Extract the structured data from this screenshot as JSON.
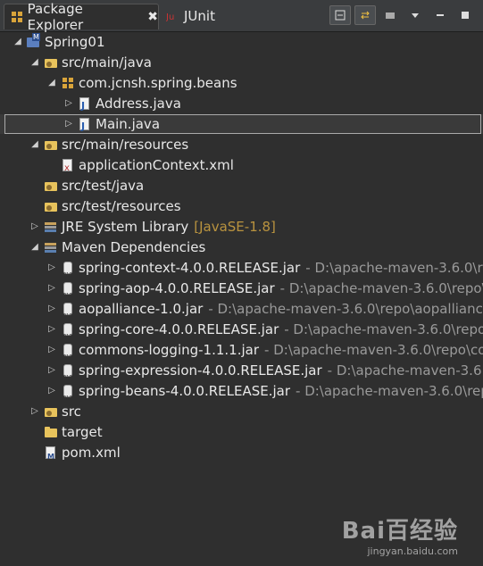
{
  "tabs": [
    {
      "label": "Package Explorer",
      "close": "✖"
    },
    {
      "label": "JUnit"
    }
  ],
  "tree": [
    {
      "label": "Spring01",
      "icon": "project-icon",
      "indent": 0,
      "expanded": true
    },
    {
      "label": "src/main/java",
      "icon": "source-folder-icon",
      "indent": 1,
      "expanded": true
    },
    {
      "label": "com.jcnsh.spring.beans",
      "icon": "package-icon",
      "indent": 2,
      "expanded": true
    },
    {
      "label": "Address.java",
      "icon": "java-file-icon",
      "indent": 3,
      "expanded": false
    },
    {
      "label": "Main.java",
      "icon": "java-file-icon",
      "indent": 3,
      "expanded": false,
      "selected": true
    },
    {
      "label": "src/main/resources",
      "icon": "source-folder-icon",
      "indent": 1,
      "expanded": true
    },
    {
      "label": "applicationContext.xml",
      "icon": "xml-file-icon",
      "indent": 2,
      "leaf": true
    },
    {
      "label": "src/test/java",
      "icon": "source-folder-icon",
      "indent": 1,
      "leaf": true
    },
    {
      "label": "src/test/resources",
      "icon": "source-folder-icon",
      "indent": 1,
      "leaf": true
    },
    {
      "label": "JRE System Library",
      "decoration": "[JavaSE-1.8]",
      "icon": "library-icon",
      "indent": 1,
      "expanded": false
    },
    {
      "label": "Maven Dependencies",
      "icon": "library-icon",
      "indent": 1,
      "expanded": true
    },
    {
      "label": "spring-context-4.0.0.RELEASE.jar",
      "decoration": "- D:\\apache-maven-3.6.0\\repo",
      "icon": "jar-icon",
      "indent": 2,
      "expanded": false
    },
    {
      "label": "spring-aop-4.0.0.RELEASE.jar",
      "decoration": "- D:\\apache-maven-3.6.0\\repo\\o",
      "icon": "jar-icon",
      "indent": 2,
      "expanded": false
    },
    {
      "label": "aopalliance-1.0.jar",
      "decoration": "- D:\\apache-maven-3.6.0\\repo\\aopalliance\\",
      "icon": "jar-icon",
      "indent": 2,
      "expanded": false
    },
    {
      "label": "spring-core-4.0.0.RELEASE.jar",
      "decoration": "- D:\\apache-maven-3.6.0\\repo\\o",
      "icon": "jar-icon",
      "indent": 2,
      "expanded": false
    },
    {
      "label": "commons-logging-1.1.1.jar",
      "decoration": "- D:\\apache-maven-3.6.0\\repo\\co",
      "icon": "jar-icon",
      "indent": 2,
      "expanded": false
    },
    {
      "label": "spring-expression-4.0.0.RELEASE.jar",
      "decoration": "- D:\\apache-maven-3.6.0\\",
      "icon": "jar-icon",
      "indent": 2,
      "expanded": false
    },
    {
      "label": "spring-beans-4.0.0.RELEASE.jar",
      "decoration": "- D:\\apache-maven-3.6.0\\repo",
      "icon": "jar-icon",
      "indent": 2,
      "expanded": false
    },
    {
      "label": "src",
      "icon": "source-folder-icon",
      "indent": 1,
      "expanded": false
    },
    {
      "label": "target",
      "icon": "folder-icon",
      "indent": 1,
      "leaf": true
    },
    {
      "label": "pom.xml",
      "icon": "pom-file-icon",
      "indent": 1,
      "leaf": true
    }
  ],
  "watermark": {
    "logo": "Bai百经验",
    "url": "jingyan.baidu.com"
  }
}
